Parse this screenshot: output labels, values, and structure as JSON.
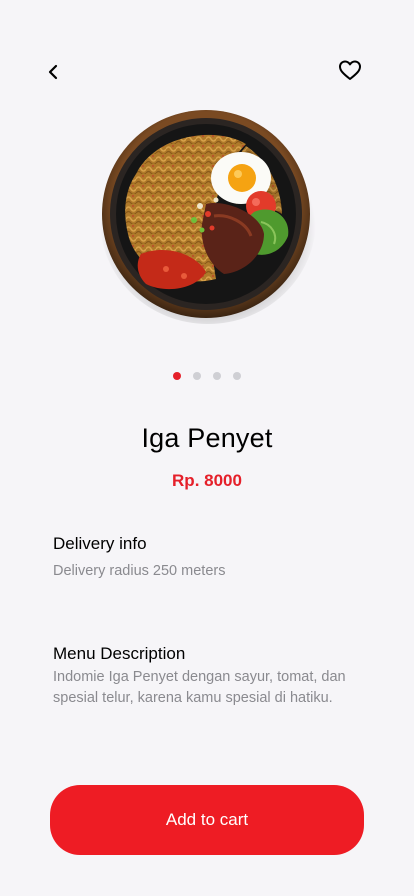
{
  "header": {
    "back_icon": "chevron-left-icon",
    "favorite_icon": "heart-outline-icon"
  },
  "product": {
    "image": "noodle-plate-image",
    "name": "Iga Penyet",
    "price": "Rp. 8000",
    "carousel": {
      "count": 4,
      "active_index": 0
    }
  },
  "delivery": {
    "title": "Delivery info",
    "text": "Delivery radius 250 meters"
  },
  "description": {
    "title": "Menu Description",
    "text": "Indomie Iga Penyet dengan sayur, tomat, dan spesial telur, karena kamu spesial di hatiku."
  },
  "cart_button": {
    "label": "Add to cart"
  },
  "colors": {
    "accent": "#ee1c24",
    "background": "#f6f5f8",
    "muted_text": "#8a8a8f"
  }
}
